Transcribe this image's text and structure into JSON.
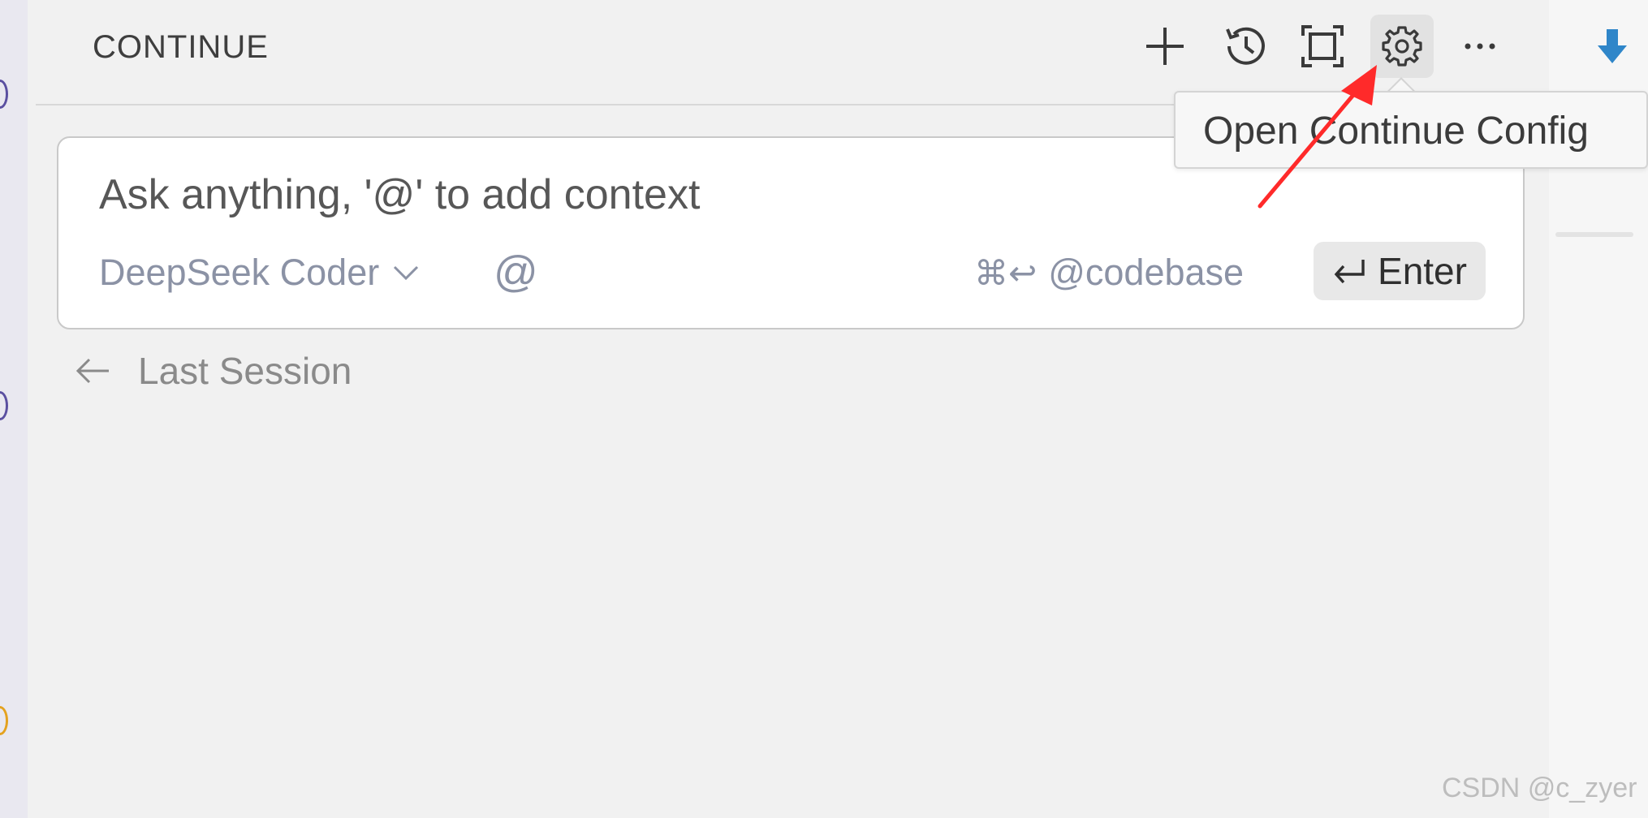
{
  "header": {
    "title": "CONTINUE",
    "toolbar": {
      "new": "plus-icon",
      "history": "history-icon",
      "fullscreen": "fullscreen-icon",
      "settings": "gear-icon",
      "more": "more-icon"
    }
  },
  "tooltip": {
    "text": "Open Continue Config"
  },
  "input": {
    "placeholder": "Ask anything, '@' to add context",
    "model": "DeepSeek Coder",
    "at_symbol": "@",
    "codebase_shortcut_symbol": "⌘↩",
    "codebase_hint": "@codebase",
    "enter_label": "Enter"
  },
  "last_session": {
    "label": "Last Session"
  },
  "watermark": "CSDN @c_zyer",
  "colors": {
    "accent_arrow": "#ff2a2a",
    "download_icon": "#2f86c9",
    "muted_text": "#8b92a5"
  }
}
